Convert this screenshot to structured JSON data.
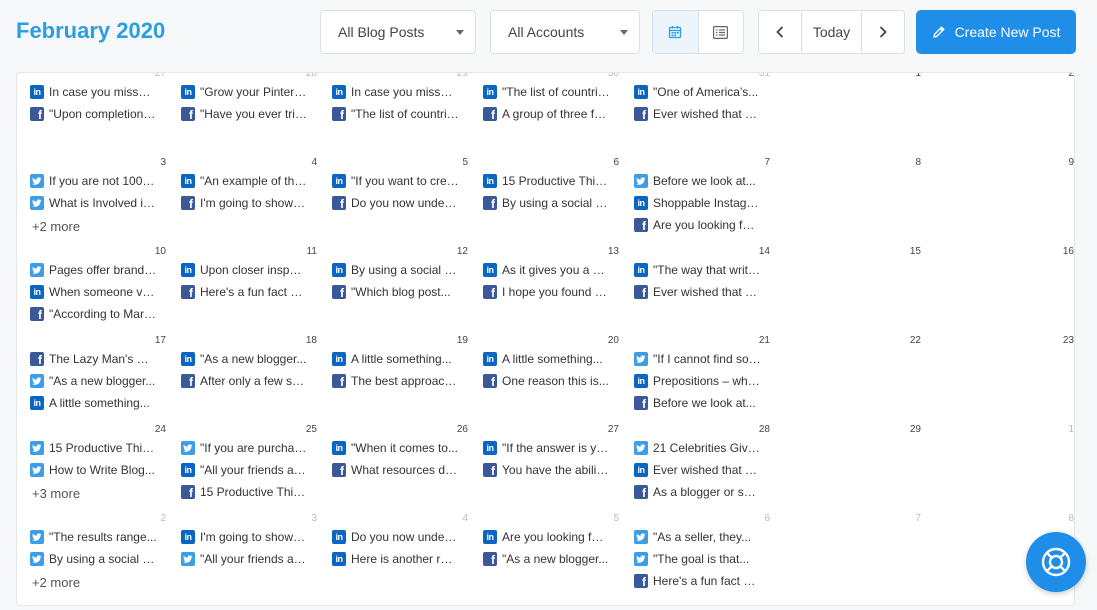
{
  "header": {
    "month_title": "February 2020",
    "filter_posts": "All Blog Posts",
    "filter_accounts": "All Accounts",
    "today_label": "Today",
    "create_label": "Create New Post"
  },
  "colors": {
    "accent": "#1e8ee8",
    "title": "#2a9ee3",
    "linkedin": "#0a66c2",
    "facebook": "#3b5998",
    "twitter": "#3d9ee8"
  },
  "weeks": [
    {
      "days": [
        {
          "num": "27",
          "muted": true,
          "posts": [
            {
              "icon": "li",
              "text": "In case you missed it..."
            },
            {
              "icon": "fb",
              "text": "\"Upon completion of..."
            }
          ],
          "more": ""
        },
        {
          "num": "28",
          "muted": true,
          "posts": [
            {
              "icon": "li",
              "text": "\"Grow your Pinterest..."
            },
            {
              "icon": "fb",
              "text": "\"Have you ever tried..."
            }
          ],
          "more": ""
        },
        {
          "num": "29",
          "muted": true,
          "posts": [
            {
              "icon": "li",
              "text": "In case you missed it..."
            },
            {
              "icon": "fb",
              "text": "\"The list of countries..."
            }
          ],
          "more": ""
        },
        {
          "num": "30",
          "muted": true,
          "posts": [
            {
              "icon": "li",
              "text": "\"The list of countries..."
            },
            {
              "icon": "fb",
              "text": "A group of three friends..."
            }
          ],
          "more": ""
        },
        {
          "num": "31",
          "muted": true,
          "posts": [
            {
              "icon": "li",
              "text": "\"One of America's..."
            },
            {
              "icon": "fb",
              "text": "Ever wished that you..."
            }
          ],
          "more": ""
        },
        {
          "num": "1",
          "muted": false,
          "posts": [],
          "more": ""
        },
        {
          "num": "2",
          "muted": false,
          "posts": [],
          "more": ""
        }
      ]
    },
    {
      "days": [
        {
          "num": "3",
          "muted": false,
          "posts": [
            {
              "icon": "tw",
              "text": "If you are not 100%..."
            },
            {
              "icon": "tw",
              "text": "What is Involved in..."
            }
          ],
          "more": "+2 more"
        },
        {
          "num": "4",
          "muted": false,
          "posts": [
            {
              "icon": "li",
              "text": "\"An example of this..."
            },
            {
              "icon": "fb",
              "text": "I'm going to show you..."
            }
          ],
          "more": ""
        },
        {
          "num": "5",
          "muted": false,
          "posts": [
            {
              "icon": "li",
              "text": "\"If you want to create..."
            },
            {
              "icon": "fb",
              "text": "Do you now understand..."
            }
          ],
          "more": ""
        },
        {
          "num": "6",
          "muted": false,
          "posts": [
            {
              "icon": "li",
              "text": "15 Productive Things..."
            },
            {
              "icon": "fb",
              "text": "By using a social media..."
            }
          ],
          "more": ""
        },
        {
          "num": "7",
          "muted": false,
          "posts": [
            {
              "icon": "tw",
              "text": "Before we look at..."
            },
            {
              "icon": "li",
              "text": "Shoppable Instagram..."
            },
            {
              "icon": "fb",
              "text": "Are you looking for..."
            }
          ],
          "more": ""
        },
        {
          "num": "8",
          "muted": false,
          "posts": [],
          "more": ""
        },
        {
          "num": "9",
          "muted": false,
          "posts": [],
          "more": ""
        }
      ]
    },
    {
      "days": [
        {
          "num": "10",
          "muted": false,
          "posts": [
            {
              "icon": "tw",
              "text": "Pages offer brands..."
            },
            {
              "icon": "li",
              "text": "When someone visits..."
            },
            {
              "icon": "fb",
              "text": "\"According to Mark..."
            }
          ],
          "more": ""
        },
        {
          "num": "11",
          "muted": false,
          "posts": [
            {
              "icon": "li",
              "text": "Upon closer inspection..."
            },
            {
              "icon": "fb",
              "text": "Here's a fun fact about..."
            }
          ],
          "more": ""
        },
        {
          "num": "12",
          "muted": false,
          "posts": [
            {
              "icon": "li",
              "text": "By using a social media..."
            },
            {
              "icon": "fb",
              "text": "\"Which blog post..."
            }
          ],
          "more": ""
        },
        {
          "num": "13",
          "muted": false,
          "posts": [
            {
              "icon": "li",
              "text": "As it gives you a chance..."
            },
            {
              "icon": "fb",
              "text": "I hope you found this..."
            }
          ],
          "more": ""
        },
        {
          "num": "14",
          "muted": false,
          "posts": [
            {
              "icon": "li",
              "text": "\"The way that writers..."
            },
            {
              "icon": "fb",
              "text": "Ever wished that you..."
            }
          ],
          "more": ""
        },
        {
          "num": "15",
          "muted": false,
          "posts": [],
          "more": ""
        },
        {
          "num": "16",
          "muted": false,
          "posts": [],
          "more": ""
        }
      ]
    },
    {
      "days": [
        {
          "num": "17",
          "muted": false,
          "posts": [
            {
              "icon": "fb",
              "text": "The Lazy Man's Guide..."
            },
            {
              "icon": "tw",
              "text": "\"As a new blogger..."
            },
            {
              "icon": "li",
              "text": "A little something..."
            }
          ],
          "more": ""
        },
        {
          "num": "18",
          "muted": false,
          "posts": [
            {
              "icon": "li",
              "text": "\"As a new blogger..."
            },
            {
              "icon": "fb",
              "text": "After only a few short..."
            }
          ],
          "more": ""
        },
        {
          "num": "19",
          "muted": false,
          "posts": [
            {
              "icon": "li",
              "text": "A little something..."
            },
            {
              "icon": "fb",
              "text": "The best approach..."
            }
          ],
          "more": ""
        },
        {
          "num": "20",
          "muted": false,
          "posts": [
            {
              "icon": "li",
              "text": "A little something..."
            },
            {
              "icon": "fb",
              "text": "One reason this is..."
            }
          ],
          "more": ""
        },
        {
          "num": "21",
          "muted": false,
          "posts": [
            {
              "icon": "tw",
              "text": "\"If I cannot find something..."
            },
            {
              "icon": "li",
              "text": "Prepositions – what..."
            },
            {
              "icon": "fb",
              "text": "Before we look at..."
            }
          ],
          "more": ""
        },
        {
          "num": "22",
          "muted": false,
          "posts": [],
          "more": ""
        },
        {
          "num": "23",
          "muted": false,
          "posts": [],
          "more": ""
        }
      ]
    },
    {
      "days": [
        {
          "num": "24",
          "muted": false,
          "posts": [
            {
              "icon": "tw",
              "text": "15 Productive Things..."
            },
            {
              "icon": "tw",
              "text": "How to Write Blog..."
            }
          ],
          "more": "+3 more"
        },
        {
          "num": "25",
          "muted": false,
          "posts": [
            {
              "icon": "tw",
              "text": "\"If you are purchasing..."
            },
            {
              "icon": "li",
              "text": "\"All your friends are..."
            },
            {
              "icon": "fb",
              "text": "15 Productive Things..."
            }
          ],
          "more": ""
        },
        {
          "num": "26",
          "muted": false,
          "posts": [
            {
              "icon": "li",
              "text": "\"When it comes to..."
            },
            {
              "icon": "fb",
              "text": "What resources do..."
            }
          ],
          "more": ""
        },
        {
          "num": "27",
          "muted": false,
          "posts": [
            {
              "icon": "li",
              "text": "\"If the answer is yes..."
            },
            {
              "icon": "fb",
              "text": "You have the ability..."
            }
          ],
          "more": ""
        },
        {
          "num": "28",
          "muted": false,
          "posts": [
            {
              "icon": "tw",
              "text": "21 Celebrities Give..."
            },
            {
              "icon": "li",
              "text": "Ever wished that you..."
            },
            {
              "icon": "fb",
              "text": "As a blogger or social..."
            }
          ],
          "more": ""
        },
        {
          "num": "29",
          "muted": false,
          "posts": [],
          "more": ""
        },
        {
          "num": "1",
          "muted": true,
          "posts": [],
          "more": ""
        }
      ]
    },
    {
      "days": [
        {
          "num": "2",
          "muted": true,
          "posts": [
            {
              "icon": "tw",
              "text": "\"The results range..."
            },
            {
              "icon": "tw",
              "text": "By using a social media..."
            }
          ],
          "more": "+2 more"
        },
        {
          "num": "3",
          "muted": true,
          "posts": [
            {
              "icon": "li",
              "text": "I'm going to show you..."
            },
            {
              "icon": "tw",
              "text": "\"All your friends are..."
            }
          ],
          "more": ""
        },
        {
          "num": "4",
          "muted": true,
          "posts": [
            {
              "icon": "li",
              "text": "Do you now understand..."
            },
            {
              "icon": "li",
              "text": "Here is another reason..."
            }
          ],
          "more": ""
        },
        {
          "num": "5",
          "muted": true,
          "posts": [
            {
              "icon": "li",
              "text": "Are you looking for..."
            },
            {
              "icon": "fb",
              "text": "\"As a new blogger..."
            }
          ],
          "more": ""
        },
        {
          "num": "6",
          "muted": true,
          "posts": [
            {
              "icon": "tw",
              "text": "\"As a seller, they..."
            },
            {
              "icon": "tw",
              "text": "\"The goal is that..."
            },
            {
              "icon": "fb",
              "text": "Here's a fun fact about..."
            }
          ],
          "more": ""
        },
        {
          "num": "7",
          "muted": true,
          "posts": [],
          "more": ""
        },
        {
          "num": "8",
          "muted": true,
          "posts": [],
          "more": ""
        }
      ]
    }
  ]
}
